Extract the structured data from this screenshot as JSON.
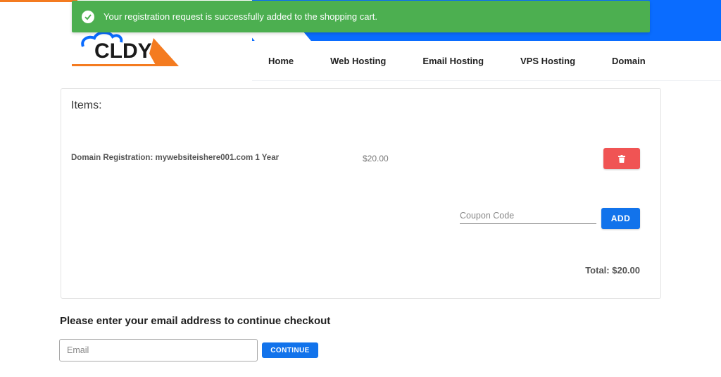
{
  "toast": {
    "message": "Your registration request is successfully added to the shopping cart.",
    "icon": "check-circle-icon",
    "color": "#4caf50"
  },
  "header": {
    "logo_text": "CLDY",
    "accent_color": "#0a6cff",
    "logo_color": "#f47b20",
    "nav": [
      {
        "label": "Home"
      },
      {
        "label": "Web Hosting"
      },
      {
        "label": "Email Hosting"
      },
      {
        "label": "VPS Hosting"
      },
      {
        "label": "Domain"
      }
    ]
  },
  "cart": {
    "title": "Items:",
    "items": [
      {
        "name": "Domain Registration: mywebsiteishere001.com 1 Year",
        "price": "$20.00",
        "delete_icon": "trash-icon"
      }
    ],
    "coupon": {
      "placeholder": "Coupon Code",
      "value": "",
      "button_label": "ADD"
    },
    "total": "Total: $20.00",
    "delete_color": "#f05454",
    "button_color": "#1273eb"
  },
  "checkout": {
    "heading": "Please enter your email address to continue checkout",
    "email_placeholder": "Email",
    "email_value": "",
    "continue_label": "CONTINUE"
  }
}
